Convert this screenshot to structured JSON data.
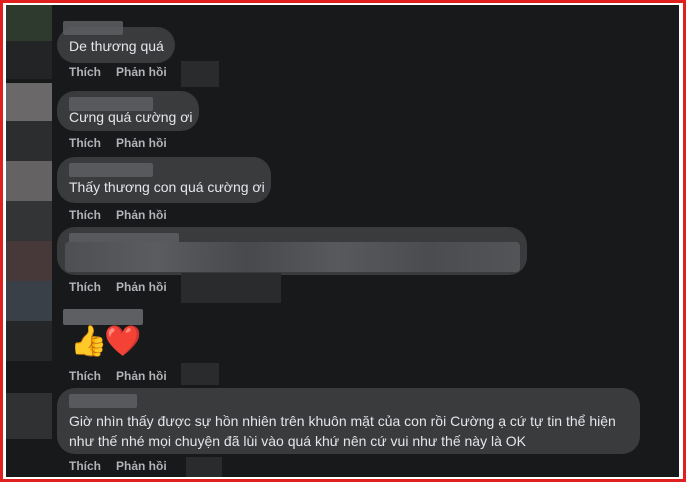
{
  "comments": [
    {
      "text": "De thương quá"
    },
    {
      "text": "Cưng quá cường ơi"
    },
    {
      "text": "Thấy thương con quá cường ơi"
    },
    {
      "text": ""
    },
    {
      "reactions": [
        "👍",
        "❤️"
      ]
    },
    {
      "text_line1": "Giờ nhìn thấy được sự hồn nhiên trên khuôn mặt của con rồi Cường ạ cứ tự tin thể hiện",
      "text_line2": "như thế nhé mọi chuyện đã lùi vào quá khứ nên cứ vui như thế này là OK"
    }
  ],
  "actions": {
    "like": "Thích",
    "reply": "Phản hồi"
  },
  "colors": {
    "frame_border": "#e0201e",
    "background": "#18191a",
    "bubble": "#3a3b3c",
    "text": "#e4e6eb",
    "action_text": "#b0b3b8"
  }
}
